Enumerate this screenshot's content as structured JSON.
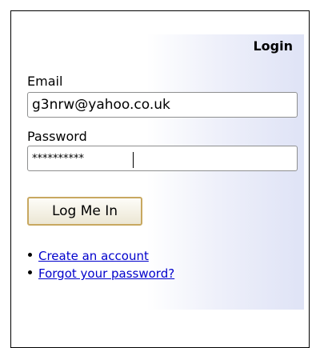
{
  "login": {
    "title": "Login",
    "email_label": "Email",
    "email_value": "g3nrw@yahoo.co.uk",
    "password_label": "Password",
    "password_value": "**********",
    "submit_label": "Log Me In",
    "links": [
      "Create an account",
      "Forgot your password?"
    ]
  }
}
